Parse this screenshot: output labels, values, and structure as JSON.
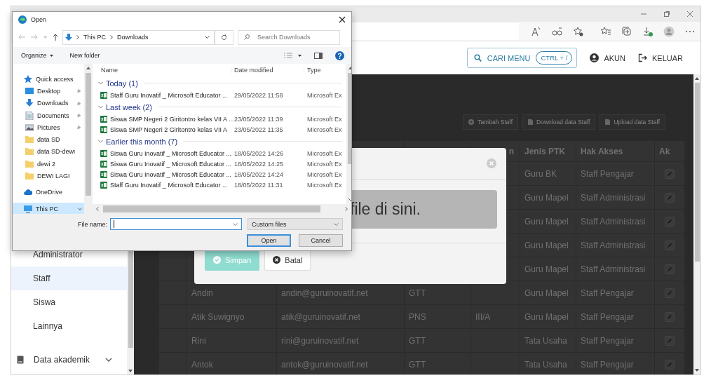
{
  "app_header": {
    "search": {
      "label": "CARI MENU",
      "shortcut": "CTRL + /"
    },
    "links": [
      {
        "label": "AKUN",
        "kind": "account"
      },
      {
        "label": "KELUAR",
        "kind": "logout"
      }
    ]
  },
  "sidebar": {
    "items": [
      {
        "label": "Administrator",
        "kind": "sub",
        "selected": false
      },
      {
        "label": "Staff",
        "kind": "sub",
        "selected": true
      },
      {
        "label": "Siswa",
        "kind": "sub",
        "selected": false
      },
      {
        "label": "Lainnya",
        "kind": "sub",
        "selected": false
      },
      {
        "label": "Data akademik",
        "kind": "section",
        "selected": false
      }
    ]
  },
  "toolbar": {
    "buttons": [
      {
        "label": "Tambah Staff",
        "kind": "add"
      },
      {
        "label": "Download data Staff",
        "kind": "file"
      },
      {
        "label": "Upload data Staff",
        "kind": "file"
      }
    ]
  },
  "table": {
    "header": {
      "column_5": "n",
      "column_6": "Jenis PTK",
      "column_7": "Hak Akses",
      "column_8": "Ak"
    },
    "rows": [
      {
        "column_6": "Guru BK",
        "column_7": "Staff Pengajar"
      },
      {
        "column_6": "Guru Mapel",
        "column_7": "Staff Administrasi"
      },
      {
        "column_6": "Guru Mapel",
        "column_7": "Staff Administrasi"
      },
      {
        "column_6": "Guru Mapel",
        "column_7": "Staff Administrasi"
      },
      {
        "column_6": "Guru Mapel",
        "column_7": "Staff Administrasi"
      },
      {
        "column_2": "Andin",
        "column_3": "andin@guruinovatif.net",
        "column_4": "GTT",
        "column_6": "Guru Mapel",
        "column_7": "Staff Pengajar"
      },
      {
        "column_2": "Atik Suwignyo",
        "column_3": "atik@guruinovatif.net",
        "column_4": "PNS",
        "column_5": "III/A",
        "column_6": "Guru Mapel",
        "column_7": "Staff Pengajar"
      },
      {
        "column_2": "Rini",
        "column_3": "rini@guruinovatif.net",
        "column_4": "GTT",
        "column_6": "Tata Usaha",
        "column_7": "Staff Pengajar"
      },
      {
        "column_2": "Antok",
        "column_3": "antok@guruinovatif.net",
        "column_4": "GTT",
        "column_6": "Tata Usaha",
        "column_7": "Staff Pengajar"
      }
    ]
  },
  "upload_modal": {
    "dropzone_text": "file di sini.",
    "buttons": [
      {
        "label": "Simpan",
        "kind": "primary",
        "disabled": true
      },
      {
        "label": "Batal",
        "kind": "cancel",
        "disabled": false
      }
    ]
  },
  "file_dialog": {
    "title": "Open",
    "path": [
      "This PC",
      "Downloads"
    ],
    "search_placeholder": "Search Downloads",
    "toolbar": [
      {
        "label": "Organize",
        "kind": "menu"
      },
      {
        "label": "New folder",
        "kind": "plain"
      }
    ],
    "nav": [
      {
        "label": "Quick access",
        "kind": "star",
        "pinned": false,
        "selected": false
      },
      {
        "label": "Desktop",
        "kind": "desktop",
        "pinned": true,
        "selected": false
      },
      {
        "label": "Downloads",
        "kind": "download",
        "pinned": true,
        "selected": false
      },
      {
        "label": "Documents",
        "kind": "document",
        "pinned": true,
        "selected": false
      },
      {
        "label": "Pictures",
        "kind": "pictures",
        "pinned": true,
        "selected": false
      },
      {
        "label": "data SD",
        "kind": "folder",
        "pinned": false,
        "selected": false
      },
      {
        "label": "data SD-dewi",
        "kind": "folder",
        "pinned": false,
        "selected": false
      },
      {
        "label": "dewi 2",
        "kind": "folder",
        "pinned": false,
        "selected": false
      },
      {
        "label": "DEWI LAGI",
        "kind": "folder",
        "pinned": false,
        "selected": false
      },
      {
        "label": "OneDrive",
        "kind": "cloud",
        "pinned": false,
        "selected": false
      },
      {
        "label": "This PC",
        "kind": "pc",
        "pinned": false,
        "selected": true
      }
    ],
    "columns": [
      "Name",
      "Date modified",
      "Type"
    ],
    "groups": [
      {
        "label": "Today (1)",
        "expanded": true,
        "files": [
          {
            "name": "Staff Guru Inovatif _ Microsoft Educator ...",
            "date": "29/05/2022 11:58",
            "type": "Microsoft Ex"
          }
        ]
      },
      {
        "label": "Last week (2)",
        "expanded": true,
        "files": [
          {
            "name": "Siswa SMP Negeri 2 Giritontro kelas VII A ...",
            "date": "23/05/2022 11:39",
            "type": "Microsoft Ex"
          },
          {
            "name": "Siswa SMP Negeri 2 Giritontro kelas VII A",
            "date": "23/05/2022 11:35",
            "type": "Microsoft Ex"
          }
        ]
      },
      {
        "label": "Earlier this month (7)",
        "expanded": true,
        "files": [
          {
            "name": "Siswa Guru Inovatif _ Microsoft Educator ...",
            "date": "18/05/2022 14:26",
            "type": "Microsoft Ex"
          },
          {
            "name": "Siswa Guru Inovatif _ Microsoft Educator ...",
            "date": "18/05/2022 14:25",
            "type": "Microsoft Ex"
          },
          {
            "name": "Siswa Guru Inovatif _ Microsoft Educator ...",
            "date": "18/05/2022 14:24",
            "type": "Microsoft Ex"
          },
          {
            "name": "Staff Guru Inovatif _ Microsoft Educator ...",
            "date": "18/05/2022 11:31",
            "type": "Microsoft Ex"
          }
        ]
      }
    ],
    "file_name_label": "File name:",
    "file_type": "Custom files",
    "buttons": [
      {
        "label": "Open",
        "kind": "default"
      },
      {
        "label": "Cancel",
        "kind": "plain"
      }
    ]
  }
}
